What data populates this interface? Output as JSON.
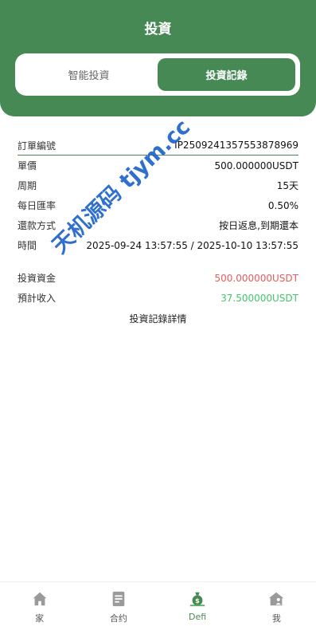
{
  "header": {
    "title": "投資"
  },
  "tabs": [
    {
      "label": "智能投資",
      "active": false
    },
    {
      "label": "投資記錄",
      "active": true
    }
  ],
  "record": {
    "order_no": {
      "label": "訂單編號",
      "value": "IP2509241357553878969"
    },
    "unit_price": {
      "label": "單價",
      "value": "500.000000USDT"
    },
    "period": {
      "label": "周期",
      "value": "15天"
    },
    "daily_rate": {
      "label": "每日匯率",
      "value": "0.50%"
    },
    "repayment": {
      "label": "還款方式",
      "value": "按日返息,到期還本"
    },
    "time": {
      "label": "時間",
      "value": "2025-09-24 13:57:55 / 2025-10-10 13:57:55"
    },
    "investment": {
      "label": "投資資金",
      "value": "500.000000USDT"
    },
    "expected_income": {
      "label": "預計收入",
      "value": "37.500000USDT"
    },
    "detail_link": "投資記錄詳情"
  },
  "watermark": "天机源码 tjym.cc",
  "colors": {
    "brand": "#468955",
    "red": "#e85a5a",
    "green": "#43c46a",
    "watermark": "#1e63c9"
  },
  "tabbar": [
    {
      "label": "家",
      "icon": "home-icon"
    },
    {
      "label": "合约",
      "icon": "contract-icon"
    },
    {
      "label": "Defi",
      "icon": "money-bag-icon",
      "active": true
    },
    {
      "label": "我",
      "icon": "profile-house-icon"
    }
  ]
}
